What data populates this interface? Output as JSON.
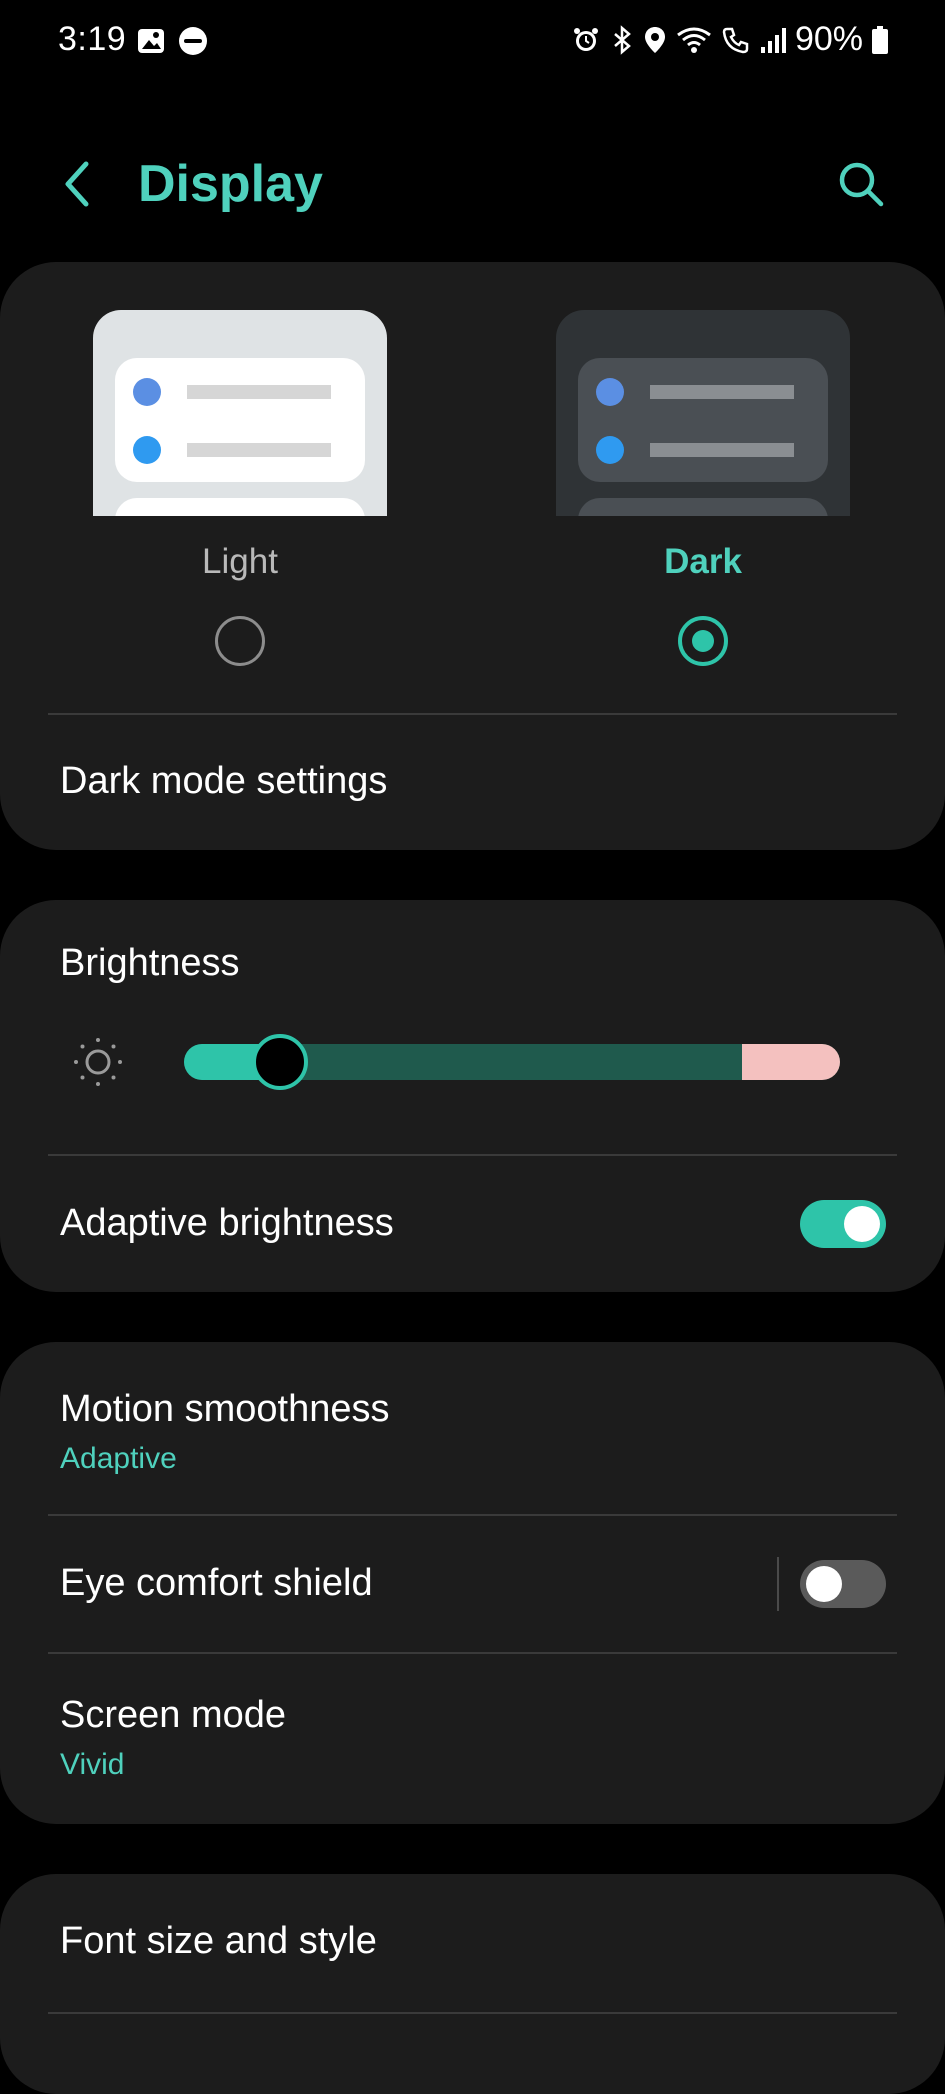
{
  "status_bar": {
    "time": "3:19",
    "battery": "90%",
    "left_icons": [
      "gallery-icon",
      "do-not-disturb-icon"
    ],
    "right_icons": [
      "alarm-icon",
      "bluetooth-icon",
      "location-icon",
      "wifi-icon",
      "wifi-call-icon",
      "signal-icon",
      "battery-icon"
    ]
  },
  "header": {
    "title": "Display",
    "back_icon": "chevron-left-icon",
    "search_icon": "search-icon"
  },
  "theme": {
    "options": [
      {
        "label": "Light",
        "selected": false
      },
      {
        "label": "Dark",
        "selected": true
      }
    ],
    "dark_mode_settings": "Dark mode settings"
  },
  "brightness": {
    "title": "Brightness",
    "level": 0.14,
    "adaptive_label": "Adaptive brightness",
    "adaptive_on": true
  },
  "display": {
    "motion_smoothness": {
      "title": "Motion smoothness",
      "value": "Adaptive"
    },
    "eye_comfort_shield": {
      "title": "Eye comfort shield",
      "on": false
    },
    "screen_mode": {
      "title": "Screen mode",
      "value": "Vivid"
    }
  },
  "font": {
    "title": "Font size and style"
  },
  "colors": {
    "accent": "#4fd1bd",
    "accent_strong": "#2ec4a9",
    "card": "#1c1c1c",
    "background": "#000000"
  }
}
